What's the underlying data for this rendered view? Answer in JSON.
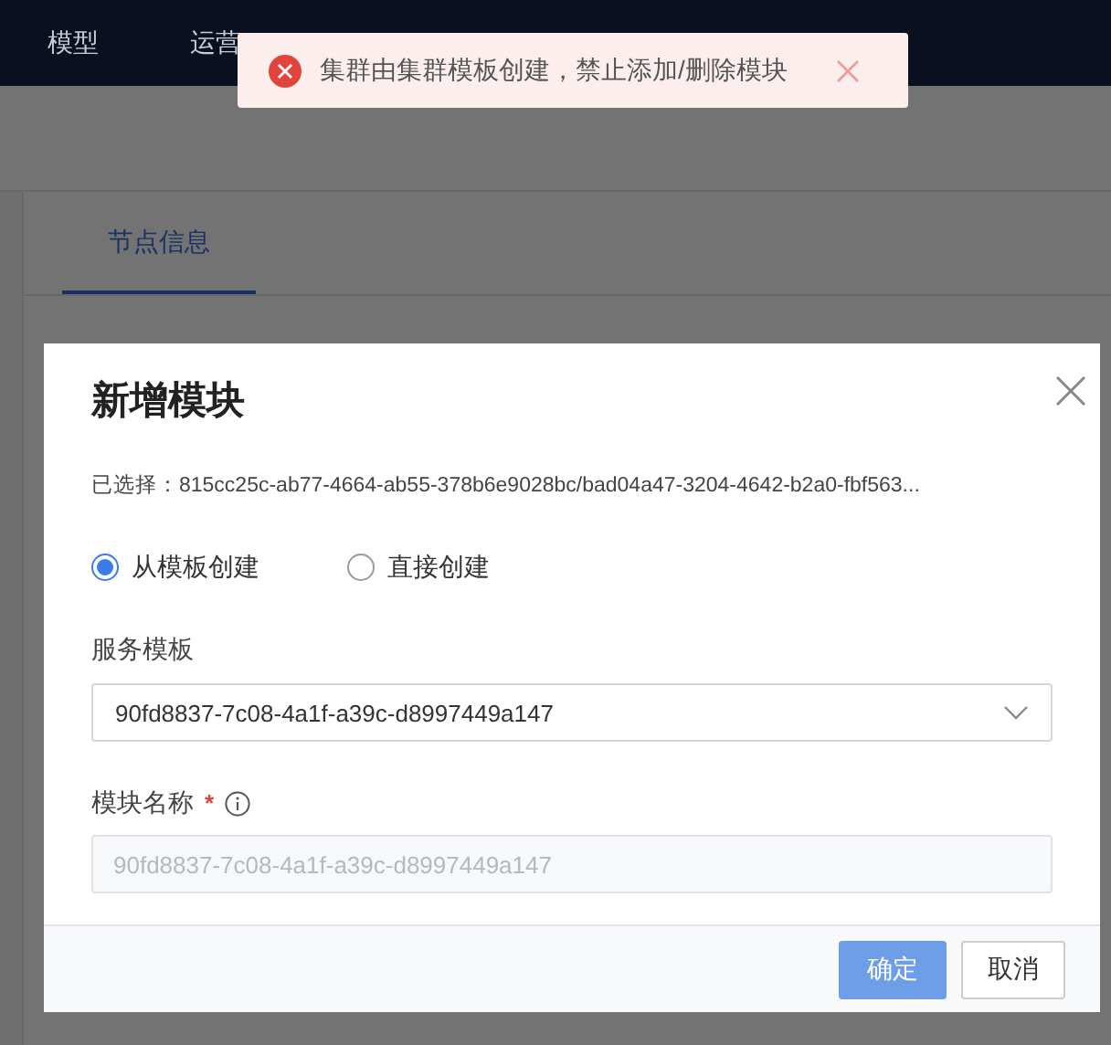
{
  "nav": {
    "items": [
      {
        "label": "模型"
      },
      {
        "label": "运营"
      }
    ]
  },
  "page": {
    "tabs": [
      {
        "label": "节点信息",
        "selected": true
      }
    ]
  },
  "toast": {
    "kind": "error",
    "message": "集群由集群模板创建，禁止添加/删除模块"
  },
  "dialog": {
    "title": "新增模块",
    "selected_text": "已选择：815cc25c-ab77-4664-ab55-378b6e9028bc/bad04a47-3204-4642-b2a0-fbf563...",
    "radios": [
      {
        "label": "从模板创建",
        "selected": true
      },
      {
        "label": "直接创建",
        "selected": false
      }
    ],
    "template_field": {
      "label": "服务模板",
      "value": "90fd8837-7c08-4a1f-a39c-d8997449a147"
    },
    "name_field": {
      "label": "模块名称",
      "required_mark": "*",
      "value": "90fd8837-7c08-4a1f-a39c-d8997449a147",
      "disabled": true
    },
    "buttons": [
      {
        "label": "确定",
        "kind": "primary",
        "disabled": true
      },
      {
        "label": "取消",
        "kind": "default",
        "disabled": false
      }
    ]
  }
}
